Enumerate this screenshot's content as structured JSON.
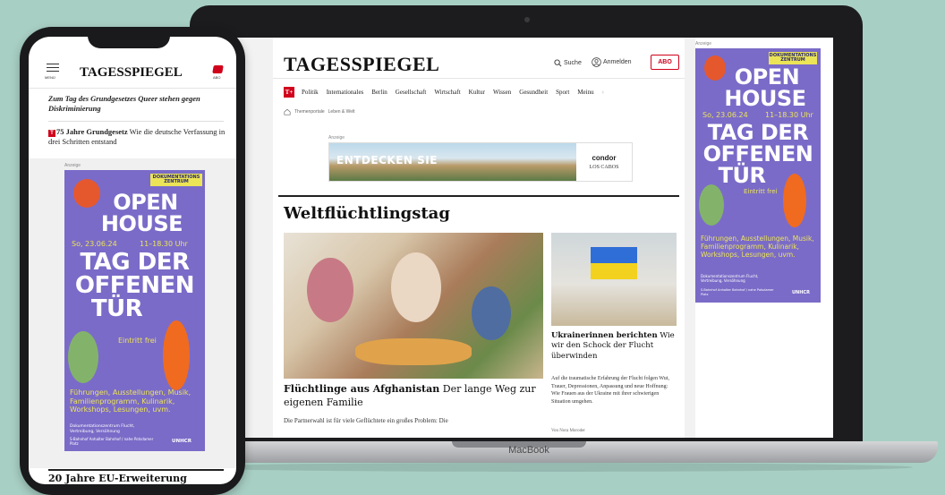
{
  "laptop": {
    "brand_label": "MacBook",
    "site": {
      "logo": "TAGESSPIEGEL",
      "search_label": "Suche",
      "login_label": "Anmelden",
      "abo_label": "ABO",
      "nav_badge": "T+",
      "nav_items": [
        "Politik",
        "Internationales",
        "Berlin",
        "Gesellschaft",
        "Wirtschaft",
        "Kultur",
        "Wissen",
        "Gesundheit",
        "Sport",
        "Meinu"
      ],
      "breadcrumb": [
        "Themenportale",
        "Leben & Welt"
      ],
      "ad_label": "Anzeige",
      "banner": {
        "text": "ENTDECKEN SIE",
        "brand": "condor",
        "dest": "LOS CABOS"
      },
      "section_title": "Weltflüchtlingstag",
      "main_article": {
        "headline_bold": "Flüchtlinge aus Afghanistan",
        "headline_rest": " Der lange Weg zur eigenen Familie",
        "teaser": "Die Partnerwahl ist für viele Geflüchtete ein großes Problem: Die"
      },
      "side_article": {
        "headline_bold": "Ukrainerinnen berichten",
        "headline_rest": " Wie wir den Schock der Flucht überwinden",
        "teaser": "Auf die traumatische Erfahrung der Flucht folgen Wut, Trauer, Depressionen, Anpassung und neue Hoffnung: Wie Frauen aus der Ukraine mit ihrer schwierigen Situation umgehen.",
        "author": "Von Nora Moroder"
      },
      "sky_label": "Anzeige"
    }
  },
  "poster": {
    "tag": "DOKUMENTATIONS ZENTRUM",
    "line1": "OPEN",
    "line2": "HOUSE",
    "date": "So, 23.06.24",
    "time": "11–18.30 Uhr",
    "line3": "TAG DER",
    "line4": "OFFENEN",
    "line5": "TÜR",
    "entry": "Eintritt frei",
    "activities": "Führungen, Ausstellungen, Musik, Familienprogramm, Kulinarik, Workshops, Lesungen, uvm.",
    "org": "Dokumentationszentrum Flucht, Vertreibung, Versöhnung",
    "address": "S-Bahnhof Anhalter Bahnhof / nahe Potsdamer Platz",
    "partner": "UNHCR"
  },
  "phone": {
    "menu_label": "MENÜ",
    "logo": "TAGESSPIEGEL",
    "abo_label": "ABO",
    "teaser1_bold": "Zum Tag des Grundgesetzes",
    "teaser1_rest": " Queer stehen gegen Diskriminierung",
    "teaser2_badge": "T",
    "teaser2_bold": "75 Jahre Grundgesetz",
    "teaser2_rest": " Wie die deutsche Verfassung in drei Schritten entstand",
    "ad_label": "Anzeige",
    "bottom_title": "20 Jahre EU-Erweiterung"
  },
  "colors": {
    "background": "#a8cfc4",
    "poster": "#7a6bc8",
    "accent_red": "#d0021b",
    "poster_yellow": "#ece457"
  }
}
